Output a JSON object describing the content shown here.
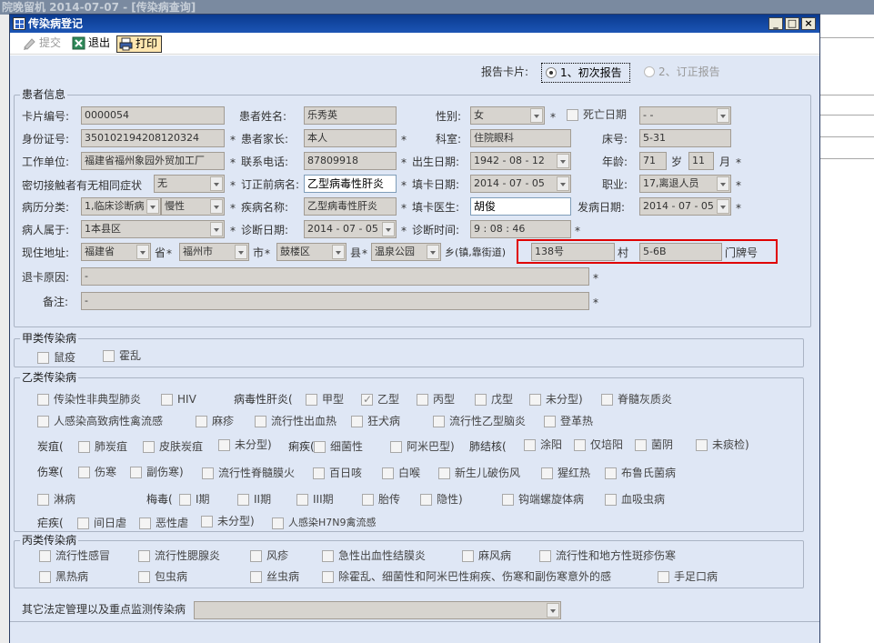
{
  "background": {
    "title": "院晚留机 2014-07-07 - [传染病查询]"
  },
  "window": {
    "title": "传染病登记",
    "btn_min": "_",
    "btn_max": "□",
    "btn_close": "×"
  },
  "toolbar": {
    "submit": "提交",
    "exit": "退出",
    "print": "打印"
  },
  "report": {
    "label": "报告卡片:",
    "opt1": "1、初次报告",
    "opt2": "2、订正报告"
  },
  "patient": {
    "group": "患者信息",
    "card_no_label": "卡片编号:",
    "card_no": "0000054",
    "name_label": "患者姓名:",
    "name": "乐秀英",
    "sex_label": "性别:",
    "sex": "女",
    "death_label": "死亡日期",
    "death": "-  -",
    "id_label": "身份证号:",
    "id": "350102194208120324",
    "parent_label": "患者家长:",
    "parent": "本人",
    "dept_label": "科室:",
    "dept": "住院眼科",
    "bed_label": "床号:",
    "bed": "5-31",
    "work_label": "工作单位:",
    "work": "福建省福州象园外贸加工厂",
    "phone_label": "联系电话:",
    "phone": "87809918",
    "birth_label": "出生日期:",
    "birth": "1942 - 08 - 12",
    "age_label": "年龄:",
    "age_y": "71",
    "age_y_unit": "岁",
    "age_m": "11",
    "age_m_unit": "月",
    "contact_label": "密切接触者有无相同症状",
    "contact": "无",
    "pre_label": "订正前病名:",
    "pre": "乙型病毒性肝炎",
    "fill_date_label": "填卡日期:",
    "fill_date": "2014 - 07 - 05",
    "job_label": "职业:",
    "job": "17,离退人员",
    "cat_label": "病历分类:",
    "cat1": "1,临床诊断病",
    "cat2": "慢性",
    "disease_label": "疾病名称:",
    "disease": "乙型病毒性肝炎",
    "doctor_label": "填卡医生:",
    "doctor": "胡俊",
    "onset_label": "发病日期:",
    "onset": "2014 - 07 - 05",
    "belong_label": "病人属于:",
    "belong": "1本县区",
    "diag_date_label": "诊断日期:",
    "diag_date": "2014 - 07 - 05",
    "diag_time_label": "诊断时间:",
    "diag_time": "9 : 08 : 46",
    "addr_label": "现住地址:",
    "province": "福建省",
    "province_unit": "省",
    "city": "福州市",
    "city_unit": "市",
    "county": "鼓楼区",
    "county_unit": "县",
    "town": "温泉公园",
    "town_unit": "乡(镇,靠街道)",
    "house": "138号",
    "village_unit": "村",
    "door": "5-6B",
    "door_unit": "门牌号",
    "return_label": "退卡原因:",
    "return_val": "-",
    "remark_label": "备注:",
    "remark_val": "-"
  },
  "classA": {
    "group": "甲类传染病",
    "items": [
      "鼠疫",
      "霍乱"
    ]
  },
  "classB": {
    "group": "乙类传染病",
    "sars": "传染性非典型肺炎",
    "hiv": "HIV",
    "hepatitis_label": "病毒性肝炎(",
    "hep_a": "甲型",
    "hep_b": "乙型",
    "hep_c": "丙型",
    "hep_e": "戊型",
    "hep_u": "未分型)",
    "polio": "脊髓灰质炎",
    "h5n1": "人感染高致病性禽流感",
    "measles": "麻疹",
    "ehf": "流行性出血热",
    "rabies": "狂犬病",
    "jeb": "流行性乙型脑炎",
    "dengue": "登革热",
    "anthrax_label": "炭疽(",
    "anthrax_lung": "肺炭疽",
    "anthrax_skin": "皮肤炭疽",
    "anthrax_u": "未分型)",
    "dys_label": "痢疾(",
    "dys_bac": "细菌性",
    "dys_amoeba": "阿米巴型)",
    "tb_label": "肺结核(",
    "tb_pos": "涂阳",
    "tb_cult": "仅培阳",
    "tb_neg": "菌阴",
    "tb_none": "未痰检)",
    "typhoid_label": "伤寒(",
    "typhoid": "伤寒",
    "paratyphoid": "副伤寒)",
    "meningitis": "流行性脊髓膜火",
    "pertussis": "百日咳",
    "diphtheria": "白喉",
    "tetanus": "新生儿破伤风",
    "scarlet": "猩红热",
    "brucella": "布鲁氏菌病",
    "gonorrhea": "淋病",
    "syphilis_label": "梅毒(",
    "syph1": "I期",
    "syph2": "II期",
    "syph3": "III期",
    "syph_fetal": "胎传",
    "syph_latent": "隐性)",
    "lepto": "钩端螺旋体病",
    "schisto": "血吸虫病",
    "malaria_label": "疟疾(",
    "vivax": "间日虐",
    "falcip": "恶性虐",
    "malaria_u": "未分型)",
    "h7n9": "人感染H7N9禽流感"
  },
  "classC": {
    "group": "丙类传染病",
    "flu": "流行性感冒",
    "mumps": "流行性腮腺炎",
    "rubella": "风疹",
    "ahc": "急性出血性结膜炎",
    "leprosy": "麻风病",
    "typhus": "流行性和地方性斑疹伤寒",
    "kala": "黑热病",
    "hydatid": "包虫病",
    "filaria": "丝虫病",
    "diarrhea": "除霍乱、细菌性和阿米巴性痢疾、伤寒和副伤寒意外的感",
    "hfmd": "手足口病"
  },
  "other": {
    "label": "其它法定管理以及重点监测传染病",
    "value": ""
  },
  "req": "*"
}
